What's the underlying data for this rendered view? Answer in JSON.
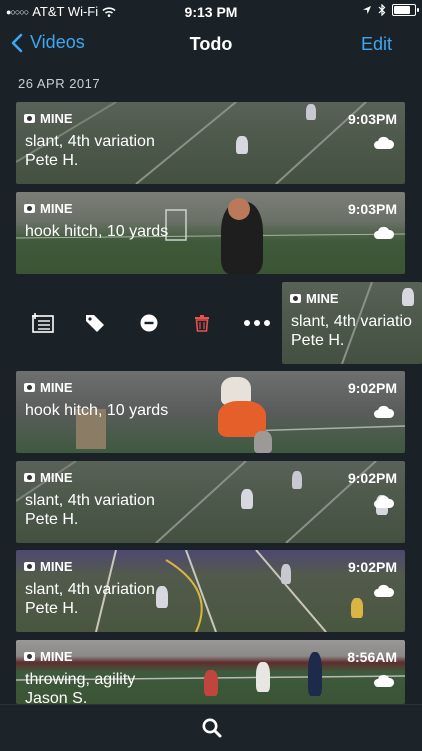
{
  "status_bar": {
    "carrier": "AT&T Wi-Fi",
    "time": "9:13 PM"
  },
  "nav": {
    "back_label": "Videos",
    "title": "Todo",
    "edit_label": "Edit"
  },
  "date_header": "26 APR 2017",
  "clips": [
    {
      "owner": "MINE",
      "title": "slant, 4th variation",
      "person": "Pete H.",
      "time": "9:03PM"
    },
    {
      "owner": "MINE",
      "title": "hook hitch, 10 yards",
      "person": "",
      "time": "9:03PM"
    },
    {
      "owner": "MINE",
      "title": "slant, 4th variatio",
      "person": "Pete H.",
      "time": ""
    },
    {
      "owner": "MINE",
      "title": "hook hitch, 10 yards",
      "person": "",
      "time": "9:02PM"
    },
    {
      "owner": "MINE",
      "title": "slant, 4th variation",
      "person": "Pete H.",
      "time": "9:02PM"
    },
    {
      "owner": "MINE",
      "title": "slant, 4th variation",
      "person": "Pete H.",
      "time": "9:02PM"
    },
    {
      "owner": "MINE",
      "title": "throwing, agility",
      "person": "Jason S.",
      "time": "8:56AM"
    }
  ],
  "swipe_actions": [
    "playlist-icon",
    "tag-icon",
    "remove-icon",
    "trash-icon",
    "more-icon"
  ],
  "colors": {
    "accent": "#3ea6f2",
    "background": "#1b2227",
    "delete": "#e8524a"
  }
}
